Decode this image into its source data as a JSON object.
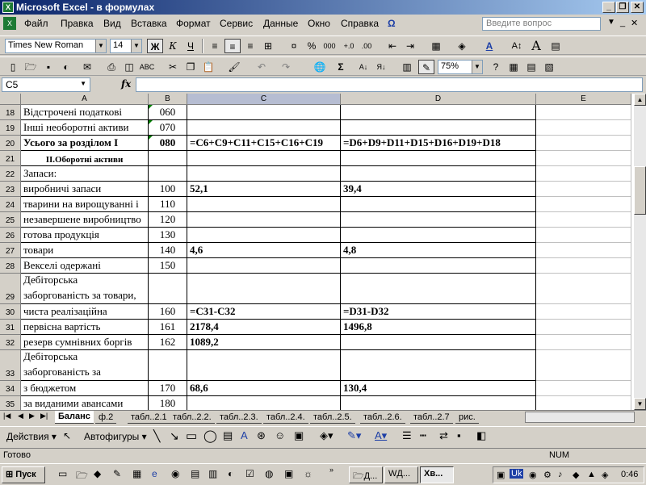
{
  "window": {
    "title": "Microsoft Excel - в формулах",
    "app_icon": "excel-icon"
  },
  "menu": {
    "items": [
      "Файл",
      "Правка",
      "Вид",
      "Вставка",
      "Формат",
      "Сервис",
      "Данные",
      "Окно",
      "Справка"
    ],
    "ask_placeholder": "Введите вопрос"
  },
  "format_toolbar": {
    "font": "Times New Roman",
    "size": "14",
    "bold": "Ж",
    "italic": "К",
    "underline": "Ч",
    "percent": "%",
    "thousands": "000",
    "font_color_letter": "A"
  },
  "std_toolbar": {
    "zoom": "75%"
  },
  "formula_bar": {
    "name_box": "C5",
    "fx": "fx",
    "formula": ""
  },
  "columns": [
    {
      "label": "A",
      "selected": false
    },
    {
      "label": "B",
      "selected": false
    },
    {
      "label": "C",
      "selected": true
    },
    {
      "label": "D",
      "selected": false
    },
    {
      "label": "E",
      "selected": false
    }
  ],
  "rows": [
    {
      "num": "18",
      "a": "Відстрочені податкові",
      "b": "060",
      "c": "",
      "d": "",
      "bold": false,
      "tri": true
    },
    {
      "num": "19",
      "a": "Інші необоротні активи",
      "b": "070",
      "c": "",
      "d": "",
      "bold": false,
      "tri": true
    },
    {
      "num": "20",
      "a": "Усього за розділом І",
      "b": "080",
      "c": "=C6+C9+C11+C15+C16+C19",
      "d": "=D6+D9+D11+D15+D16+D19+D18",
      "bold": true,
      "tri": true
    },
    {
      "num": "21",
      "a": "ІІ.Оборотні активи",
      "b": "",
      "c": "",
      "d": "",
      "bold": true,
      "small": true
    },
    {
      "num": "22",
      "a": "Запаси:",
      "b": "",
      "c": "",
      "d": ""
    },
    {
      "num": "23",
      "a": "виробничі запаси",
      "b": "100",
      "c": "52,1",
      "d": "39,4"
    },
    {
      "num": "24",
      "a": "тварини на вирощуванні і",
      "b": "110",
      "c": "",
      "d": ""
    },
    {
      "num": "25",
      "a": "незавершене виробництво",
      "b": "120",
      "c": "",
      "d": ""
    },
    {
      "num": "26",
      "a": "готова продукція",
      "b": "130",
      "c": "",
      "d": ""
    },
    {
      "num": "27",
      "a": "товари",
      "b": "140",
      "c": "4,6",
      "d": "4,8"
    },
    {
      "num": "28",
      "a": "Векселі одержані",
      "b": "150",
      "c": "",
      "d": ""
    },
    {
      "num": "29",
      "a": "Дебіторська заборгованість за товари,",
      "b": "",
      "c": "",
      "d": "",
      "tall": true
    },
    {
      "num": "30",
      "a": "чиста реалізаційна",
      "b": "160",
      "c": "=C31-C32",
      "d": "=D31-D32"
    },
    {
      "num": "31",
      "a": "первісна вартість",
      "b": "161",
      "c": "2178,4",
      "d": "1496,8"
    },
    {
      "num": "32",
      "a": "резерв сумнівних боргів",
      "b": "162",
      "c": "1089,2",
      "d": ""
    },
    {
      "num": "33",
      "a": "Дебіторська заборгованість за",
      "b": "",
      "c": "",
      "d": "",
      "tall": true
    },
    {
      "num": "34",
      "a": "з бюджетом",
      "b": "170",
      "c": "68,6",
      "d": "130,4"
    },
    {
      "num": "35",
      "a": "за виданими авансами",
      "b": "180",
      "c": "",
      "d": ""
    }
  ],
  "sheet_tabs": [
    "Баланс",
    "ф.2",
    "табл..2.1",
    "табл..2.2.",
    "табл..2.3.",
    "табл..2.4.",
    "табл..2.5.",
    "табл..2.6.",
    "табл..2.7",
    "рис."
  ],
  "draw_toolbar": {
    "actions": "Действия",
    "autoshapes": "Автофигуры"
  },
  "status": {
    "left": "Готово",
    "num": "NUM"
  },
  "taskbar": {
    "start": "Пуск",
    "tasks": [
      "Д...",
      "Д...",
      "в..."
    ],
    "clock": "0:46",
    "lang": "Uk"
  }
}
